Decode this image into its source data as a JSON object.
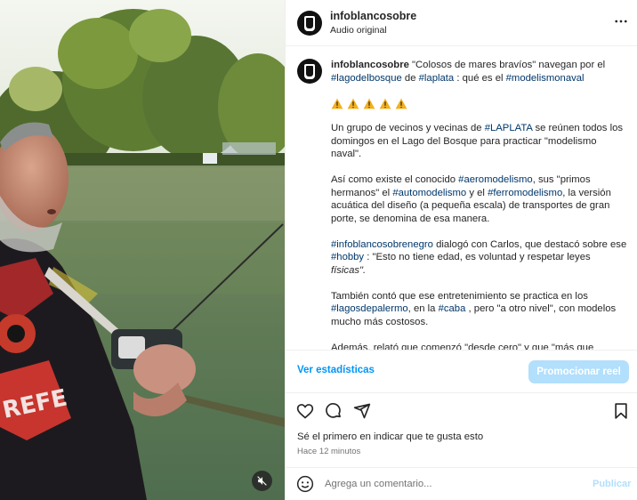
{
  "post": {
    "username": "infoblancosobre",
    "audio": "Audio original"
  },
  "caption": {
    "username": "infoblancosobre",
    "intro": "\"Colosos de mares bravíos\" navegan por el",
    "tag_lago": "#lagodelbosque",
    "de": "de",
    "tag_laplata": "#laplata",
    "que_es": ": qué es el",
    "tag_modelismo": "#modelismonaval",
    "warning_count": 5,
    "p2_a": "Un grupo de vecinos y vecinas de",
    "p2_tag": "#LAPLATA",
    "p2_b": "se reúnen todos los domingos en el Lago del Bosque para practicar \"modelismo naval\".",
    "p3_a": "Así como existe el conocido",
    "p3_tag1": "#aeromodelismo",
    "p3_b": ", sus \"primos hermanos\" el",
    "p3_tag2": "#automodelismo",
    "p3_c": "y el",
    "p3_tag3": "#ferromodelismo",
    "p3_d": ", la versión acuática del diseño (a pequeña escala) de transportes de gran porte, se denomina de esa manera.",
    "p4_tag1": "#infoblancosobrenegro",
    "p4_a": "dialogó con Carlos, que destacó sobre ese",
    "p4_tag2": "#hobby",
    "p4_b": ": \"Esto no tiene edad, es voluntad y respetar leyes",
    "p4_c": "físicas\".",
    "p5_a": "También contó que ese entretenimiento se practica en los",
    "p5_tag1": "#lagosdepalermo",
    "p5_b": ", en la",
    "p5_tag2": "#caba",
    "p5_c": ", pero \"a otro nivel\", con modelos mucho más costosos.",
    "p6": "Además, relató que comenzó \"desde cero\" y que \"más que"
  },
  "stats": {
    "link": "Ver estadísticas",
    "promote": "Promocionar reel"
  },
  "engagement": {
    "likes": "Sé el primero en indicar que te gusta esto",
    "time": "Hace 12 minutos"
  },
  "comment": {
    "placeholder": "Agrega un comentario...",
    "post": "Publicar"
  },
  "colors": {
    "link": "#0095f6",
    "hashtag": "#00376b",
    "promote_bg": "#b2dffc",
    "warning": "#f2b01e"
  }
}
